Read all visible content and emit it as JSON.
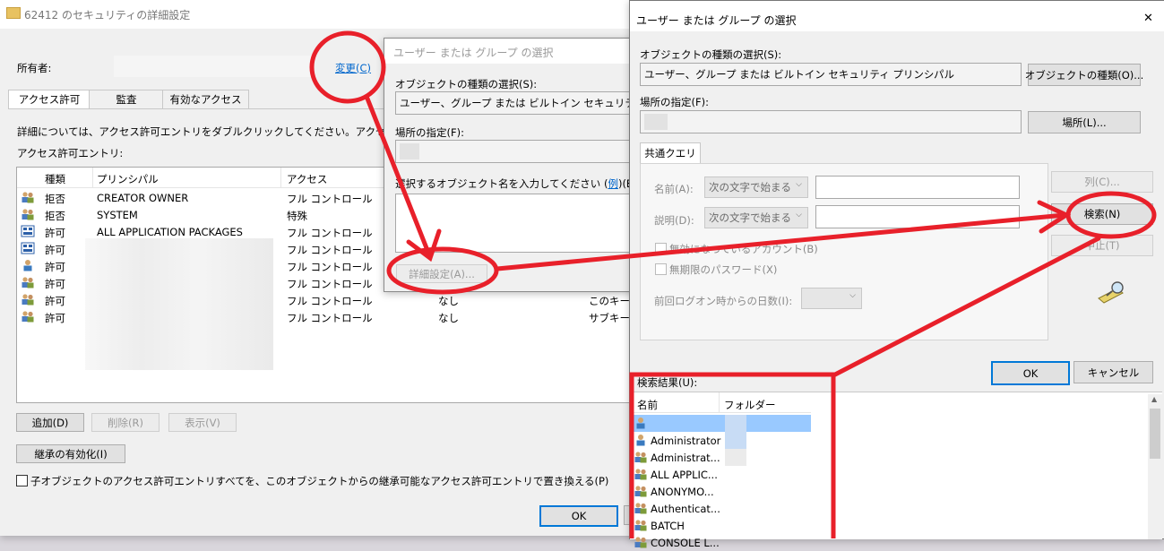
{
  "adv": {
    "title": "62412 のセキュリティの詳細設定",
    "owner_label": "所有者:",
    "change_link": "変更(C)",
    "tabs": [
      "アクセス許可",
      "監査",
      "有効なアクセス"
    ],
    "info_text": "詳細については、アクセス許可エントリをダブルクリックしてください。アクセス許可エ",
    "entries_label": "アクセス許可エントリ:",
    "columns": [
      "種類",
      "プリンシパル",
      "アクセス"
    ],
    "rows": [
      {
        "type": "拒否",
        "principal": "CREATOR OWNER",
        "access": "フル コントロール",
        "icon": "group-icon",
        "inherited": "",
        "applies": ""
      },
      {
        "type": "拒否",
        "principal": "SYSTEM",
        "access": "特殊",
        "icon": "group-icon",
        "inherited": "",
        "applies": ""
      },
      {
        "type": "許可",
        "principal": "ALL APPLICATION PACKAGES",
        "access": "フル コントロール",
        "icon": "package-icon",
        "inherited": "",
        "applies": ""
      },
      {
        "type": "許可",
        "principal": "",
        "access": "フル コントロール",
        "icon": "package-icon",
        "inherited": "",
        "applies": ""
      },
      {
        "type": "許可",
        "principal": "",
        "access": "フル コントロール",
        "icon": "user-icon",
        "inherited": "",
        "applies": ""
      },
      {
        "type": "許可",
        "principal": "",
        "access": "フル コントロール",
        "icon": "group-icon",
        "inherited": "",
        "applies": ""
      },
      {
        "type": "許可",
        "principal": "",
        "access": "フル コントロール",
        "icon": "group-icon",
        "inherited": "なし",
        "applies": "このキーと"
      },
      {
        "type": "許可",
        "principal": "",
        "access": "フル コントロール",
        "icon": "group-icon",
        "inherited": "なし",
        "applies": "サブキーの"
      }
    ],
    "add_btn": "追加(D)",
    "remove_btn": "削除(R)",
    "view_btn": "表示(V)",
    "inherit_btn": "継承の有効化(I)",
    "replace_checkbox": "子オブジェクトのアクセス許可エントリすべてを、このオブジェクトからの継承可能なアクセス許可エントリで置き換える(P)",
    "ok_btn": "OK"
  },
  "small": {
    "title": "ユーザー または グループ の選択",
    "objtype_label": "オブジェクトの種類の選択(S):",
    "objtype_value": "ユーザー、グループ または ビルトイン セキュリティ プリンシパル",
    "location_label": "場所の指定(F):",
    "enter_label": "選択するオブジェクト名を入力してください (",
    "example_link": "例",
    "enter_label_end": ")(E):",
    "advanced_btn": "詳細設定(A)..."
  },
  "big": {
    "title": "ユーザー または グループ の選択",
    "close": "✕",
    "objtype_label": "オブジェクトの種類の選択(S):",
    "objtype_value": "ユーザー、グループ または ビルトイン セキュリティ プリンシパル",
    "objtype_btn": "オブジェクトの種類(O)...",
    "location_label": "場所の指定(F):",
    "location_btn": "場所(L)...",
    "tab_common": "共通クエリ",
    "name_label": "名前(A):",
    "desc_label": "説明(D):",
    "starts_with": "次の文字で始まる",
    "disabled_accounts": "無効になっているアカウント(B)",
    "no_expire": "無期限のパスワード(X)",
    "days_label": "前回ログオン時からの日数(I):",
    "columns_btn": "列(C)...",
    "search_btn": "検索(N)",
    "stop_btn": "中止(T)",
    "ok_btn": "OK",
    "cancel_btn": "キャンセル",
    "results_label": "検索結果(U):",
    "result_columns": [
      "名前",
      "フォルダー"
    ],
    "results": [
      {
        "name": "",
        "icon": "user-icon"
      },
      {
        "name": "Administrator",
        "icon": "user-icon"
      },
      {
        "name": "Administrat...",
        "icon": "group-icon"
      },
      {
        "name": "ALL APPLIC...",
        "icon": "group-icon"
      },
      {
        "name": "ANONYMO...",
        "icon": "group-icon"
      },
      {
        "name": "Authenticat...",
        "icon": "group-icon"
      },
      {
        "name": "BATCH",
        "icon": "group-icon"
      },
      {
        "name": "CONSOLE L...",
        "icon": "group-icon"
      }
    ]
  },
  "colors": {
    "annotation": "#e8202a",
    "link": "#0066cc",
    "selection": "#99c9ff",
    "focus": "#0078d7"
  }
}
